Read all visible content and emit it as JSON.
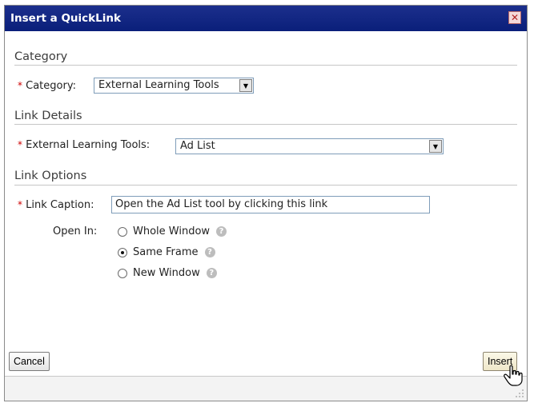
{
  "dialog": {
    "title": "Insert a QuickLink",
    "close_icon": "close-icon"
  },
  "sections": {
    "category": "Category",
    "link_details": "Link Details",
    "link_options": "Link Options"
  },
  "required_marker": "*",
  "category": {
    "label": "Category:",
    "value": "External Learning Tools"
  },
  "external_tools": {
    "label": "External Learning Tools:",
    "value": "Ad List"
  },
  "link_caption": {
    "label": "Link Caption:",
    "value": "Open the Ad List tool by clicking this link"
  },
  "open_in": {
    "label": "Open In:",
    "options": [
      {
        "label": "Whole Window",
        "checked": false
      },
      {
        "label": "Same Frame",
        "checked": true
      },
      {
        "label": "New Window",
        "checked": false
      }
    ]
  },
  "buttons": {
    "cancel": "Cancel",
    "insert": "Insert"
  },
  "colors": {
    "titlebar": "#0a1f7a",
    "required": "#cc0000",
    "section_text": "#3c3c3c"
  }
}
